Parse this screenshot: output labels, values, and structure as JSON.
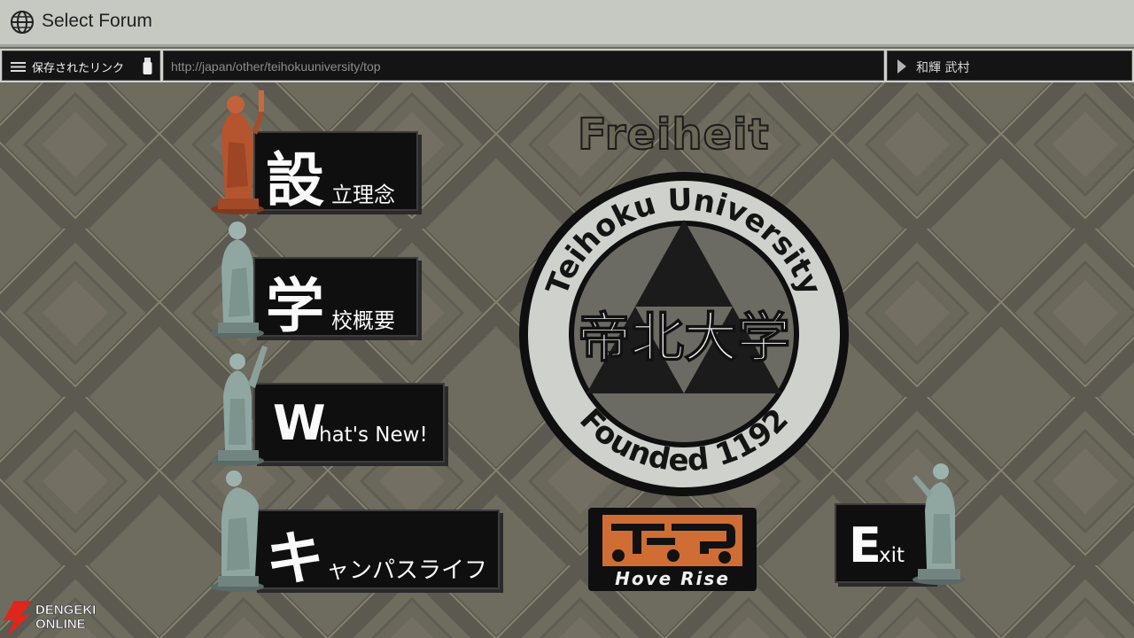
{
  "window": {
    "title": "Select Forum",
    "icon": "globe-icon"
  },
  "address_bar": {
    "links_label": "保存されたリンク",
    "url": "http://japan/other/teihokuuniversity/top",
    "user_name": "和輝 武村"
  },
  "menu": {
    "philosophy": {
      "big": "設",
      "rest": "立理念"
    },
    "overview": {
      "big": "学",
      "rest": "校概要"
    },
    "whats_new": {
      "big": "W",
      "rest": "hat's New!"
    },
    "campus_life": {
      "big": "キ",
      "rest": "ャンパスライフ"
    },
    "exit": {
      "big": "E",
      "rest": "xit"
    }
  },
  "header_text": "Freiheit",
  "emblem": {
    "top_text": "Teihoku University",
    "name": "帝北大学",
    "bottom_text": "Founded 1192"
  },
  "hp_logo": {
    "caption": "Hove Rise"
  },
  "watermark": {
    "line1": "DENGEKI",
    "line2": "ONLINE"
  },
  "colors": {
    "background": "#6e6b5f",
    "button": "#0f0f0f",
    "accent_orange": "#cf6d34",
    "statue_red": "#b4552f",
    "statue_teal": "#8fa6a1"
  }
}
